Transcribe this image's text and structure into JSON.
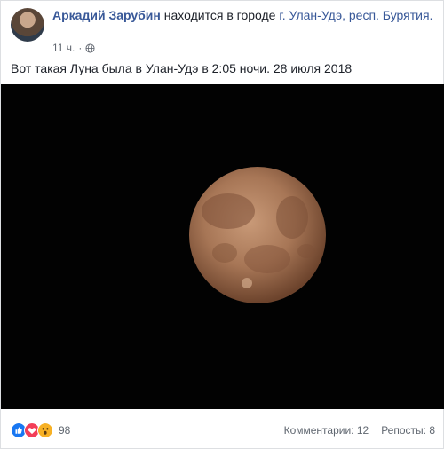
{
  "post": {
    "author": "Аркадий Зарубин",
    "location_prefix": "находится в городе",
    "location": "г. Улан-Удэ, респ. Бурятия.",
    "time": "11 ч.",
    "privacy_icon": "globe-icon",
    "caption": "Вот такая Луна была в Улан-Удэ в 2:05 ночи. 28 июля 2018"
  },
  "reactions": {
    "icons": [
      "like-icon",
      "love-icon",
      "wow-icon"
    ],
    "count": "98",
    "comments": "Комментарии: 12",
    "shares": "Репосты: 8"
  },
  "colors": {
    "link": "#385898",
    "like": "#1877f2",
    "love": "#f33e58",
    "wow": "#f7b125",
    "moon": "#b07c5c"
  }
}
